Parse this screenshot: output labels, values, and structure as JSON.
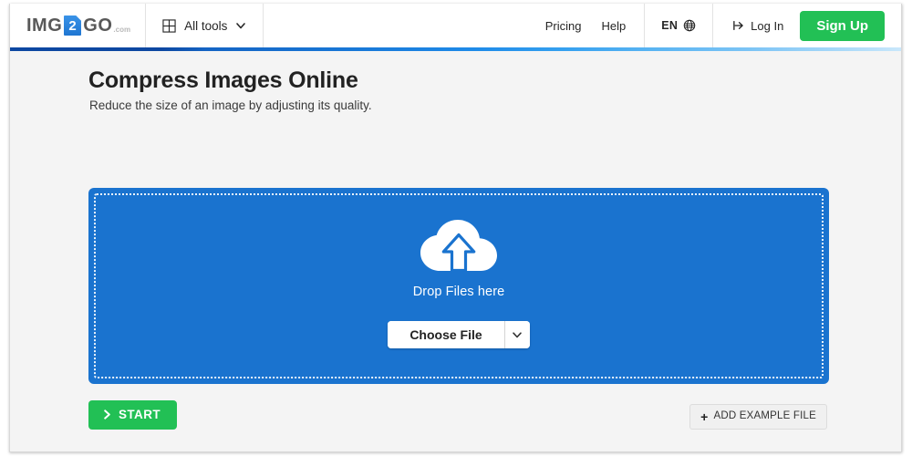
{
  "header": {
    "logo": {
      "segment_one": "IMG",
      "badge_text": "2",
      "segment_two": "GO",
      "suffix": ".com",
      "icon_name": "document-icon"
    },
    "all_tools": {
      "label": "All tools",
      "grid_icon": "grid-icon",
      "chevron_icon": "chevron-down-icon"
    },
    "nav": [
      {
        "label": "Pricing"
      },
      {
        "label": "Help"
      }
    ],
    "language": {
      "label": "EN",
      "icon": "globe-icon"
    },
    "login": {
      "label": "Log In",
      "icon": "login-arrow-icon"
    },
    "signup": {
      "label": "Sign Up"
    }
  },
  "main": {
    "title": "Compress Images Online",
    "subtitle": "Reduce the size of an image by adjusting its quality.",
    "dropzone": {
      "upload_icon": "cloud-upload-icon",
      "label": "Drop Files here",
      "choose_file_label": "Choose File",
      "choose_file_chevron": "chevron-down-icon"
    },
    "start_button": {
      "label": "START",
      "icon": "chevron-right-icon"
    },
    "example_button": {
      "label": "ADD EXAMPLE FILE",
      "icon": "plus-icon"
    }
  },
  "colors": {
    "brand_blue": "#1a73cf",
    "accent_green": "#22c055",
    "page_bg": "#f4f4f4",
    "header_bg": "#ffffff",
    "gradient_start": "#0d47a1",
    "gradient_end": "#c9e7fb"
  }
}
